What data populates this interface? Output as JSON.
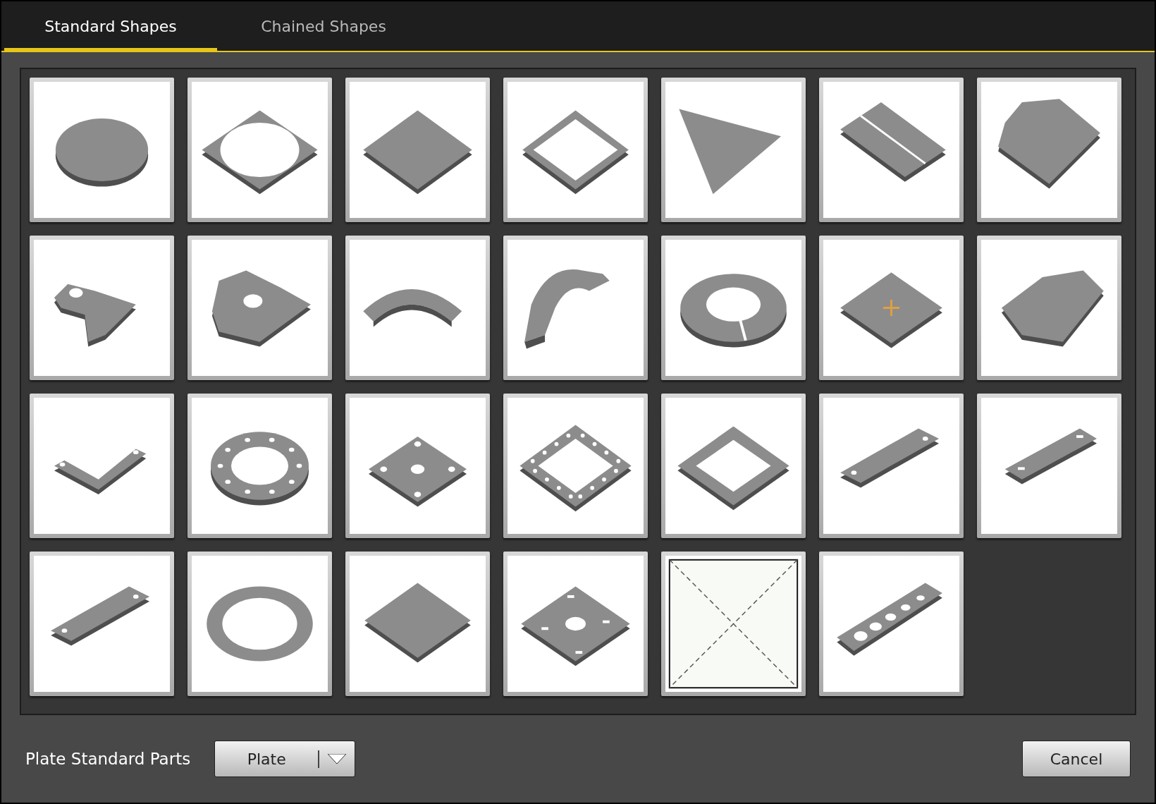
{
  "tabs": [
    {
      "label": "Standard Shapes",
      "selected": true
    },
    {
      "label": "Chained Shapes",
      "selected": false
    }
  ],
  "shapes": [
    {
      "kind": "disc"
    },
    {
      "kind": "square-round-hole"
    },
    {
      "kind": "square"
    },
    {
      "kind": "square-frame"
    },
    {
      "kind": "triangle"
    },
    {
      "kind": "split-plate"
    },
    {
      "kind": "chamfered-plate"
    },
    {
      "kind": "lug"
    },
    {
      "kind": "round-lug"
    },
    {
      "kind": "arc"
    },
    {
      "kind": "saddle"
    },
    {
      "kind": "slit-ring"
    },
    {
      "kind": "cross-square"
    },
    {
      "kind": "d-plate"
    },
    {
      "kind": "angle"
    },
    {
      "kind": "flange"
    },
    {
      "kind": "four-hole-plate"
    },
    {
      "kind": "holed-frame"
    },
    {
      "kind": "rounded-frame"
    },
    {
      "kind": "two-hole-bar"
    },
    {
      "kind": "slotted-bar"
    },
    {
      "kind": "two-hole-bar"
    },
    {
      "kind": "ring"
    },
    {
      "kind": "rounded-square"
    },
    {
      "kind": "slotted-plate"
    },
    {
      "kind": "blank"
    },
    {
      "kind": "holed-bar"
    }
  ],
  "footer": {
    "label": "Plate Standard Parts",
    "dropdown": {
      "value": "Plate"
    },
    "cancel": "Cancel"
  }
}
